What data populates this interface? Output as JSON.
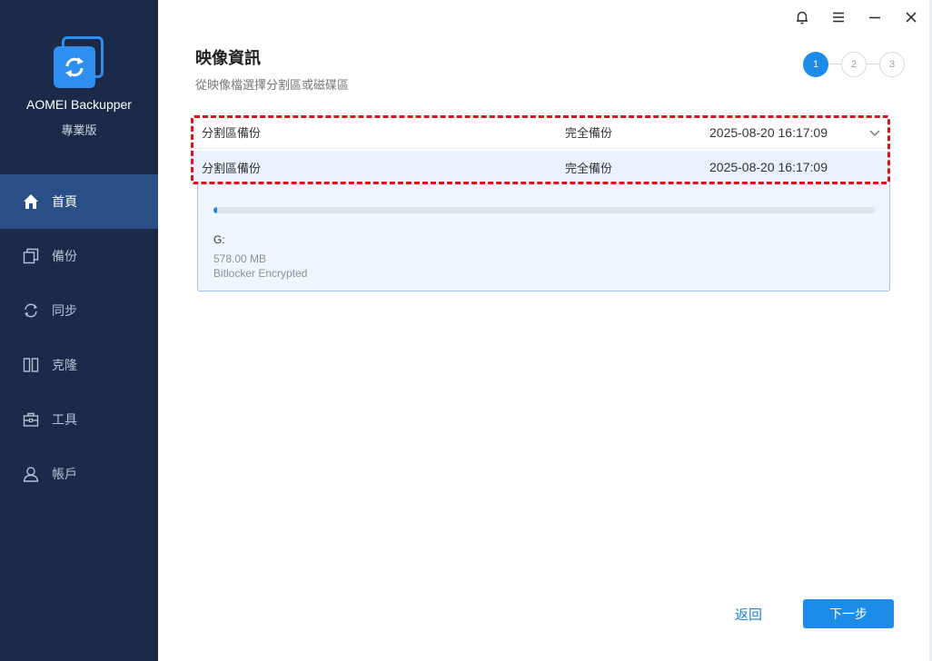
{
  "app": {
    "name": "AOMEI Backupper",
    "edition": "專業版",
    "brand_color": "#2e8ff0",
    "sidebar_color": "#1c2a4a",
    "active_color": "#2a4f87"
  },
  "window_controls": {
    "bell": "bell-icon",
    "menu": "menu-icon",
    "minimize": "minimize-icon",
    "close": "close-icon"
  },
  "sidebar": {
    "items": [
      {
        "label": "首頁",
        "icon": "home-icon",
        "active": true
      },
      {
        "label": "備份",
        "icon": "backup-icon",
        "active": false
      },
      {
        "label": "同步",
        "icon": "sync-icon",
        "active": false
      },
      {
        "label": "克隆",
        "icon": "clone-icon",
        "active": false
      },
      {
        "label": "工具",
        "icon": "tools-icon",
        "active": false
      },
      {
        "label": "帳戶",
        "icon": "account-icon",
        "active": false
      }
    ]
  },
  "header": {
    "title": "映像資訊",
    "subtitle": "從映像檔選擇分割區或磁碟區"
  },
  "steps": [
    "1",
    "2",
    "3"
  ],
  "current_step": 1,
  "image_dropdown": {
    "selected": {
      "name": "分割區備份",
      "type": "完全備份",
      "time": "2025-08-20 16:17:09"
    },
    "options": [
      {
        "name": "分割區備份",
        "type": "完全備份",
        "time": "2025-08-20 16:17:09"
      }
    ]
  },
  "partition": {
    "letter": "G:",
    "size": "578.00 MB",
    "status": "Bitlocker Encrypted",
    "used_fraction": 0.004
  },
  "footer": {
    "back_label": "返回",
    "next_label": "下一步"
  }
}
